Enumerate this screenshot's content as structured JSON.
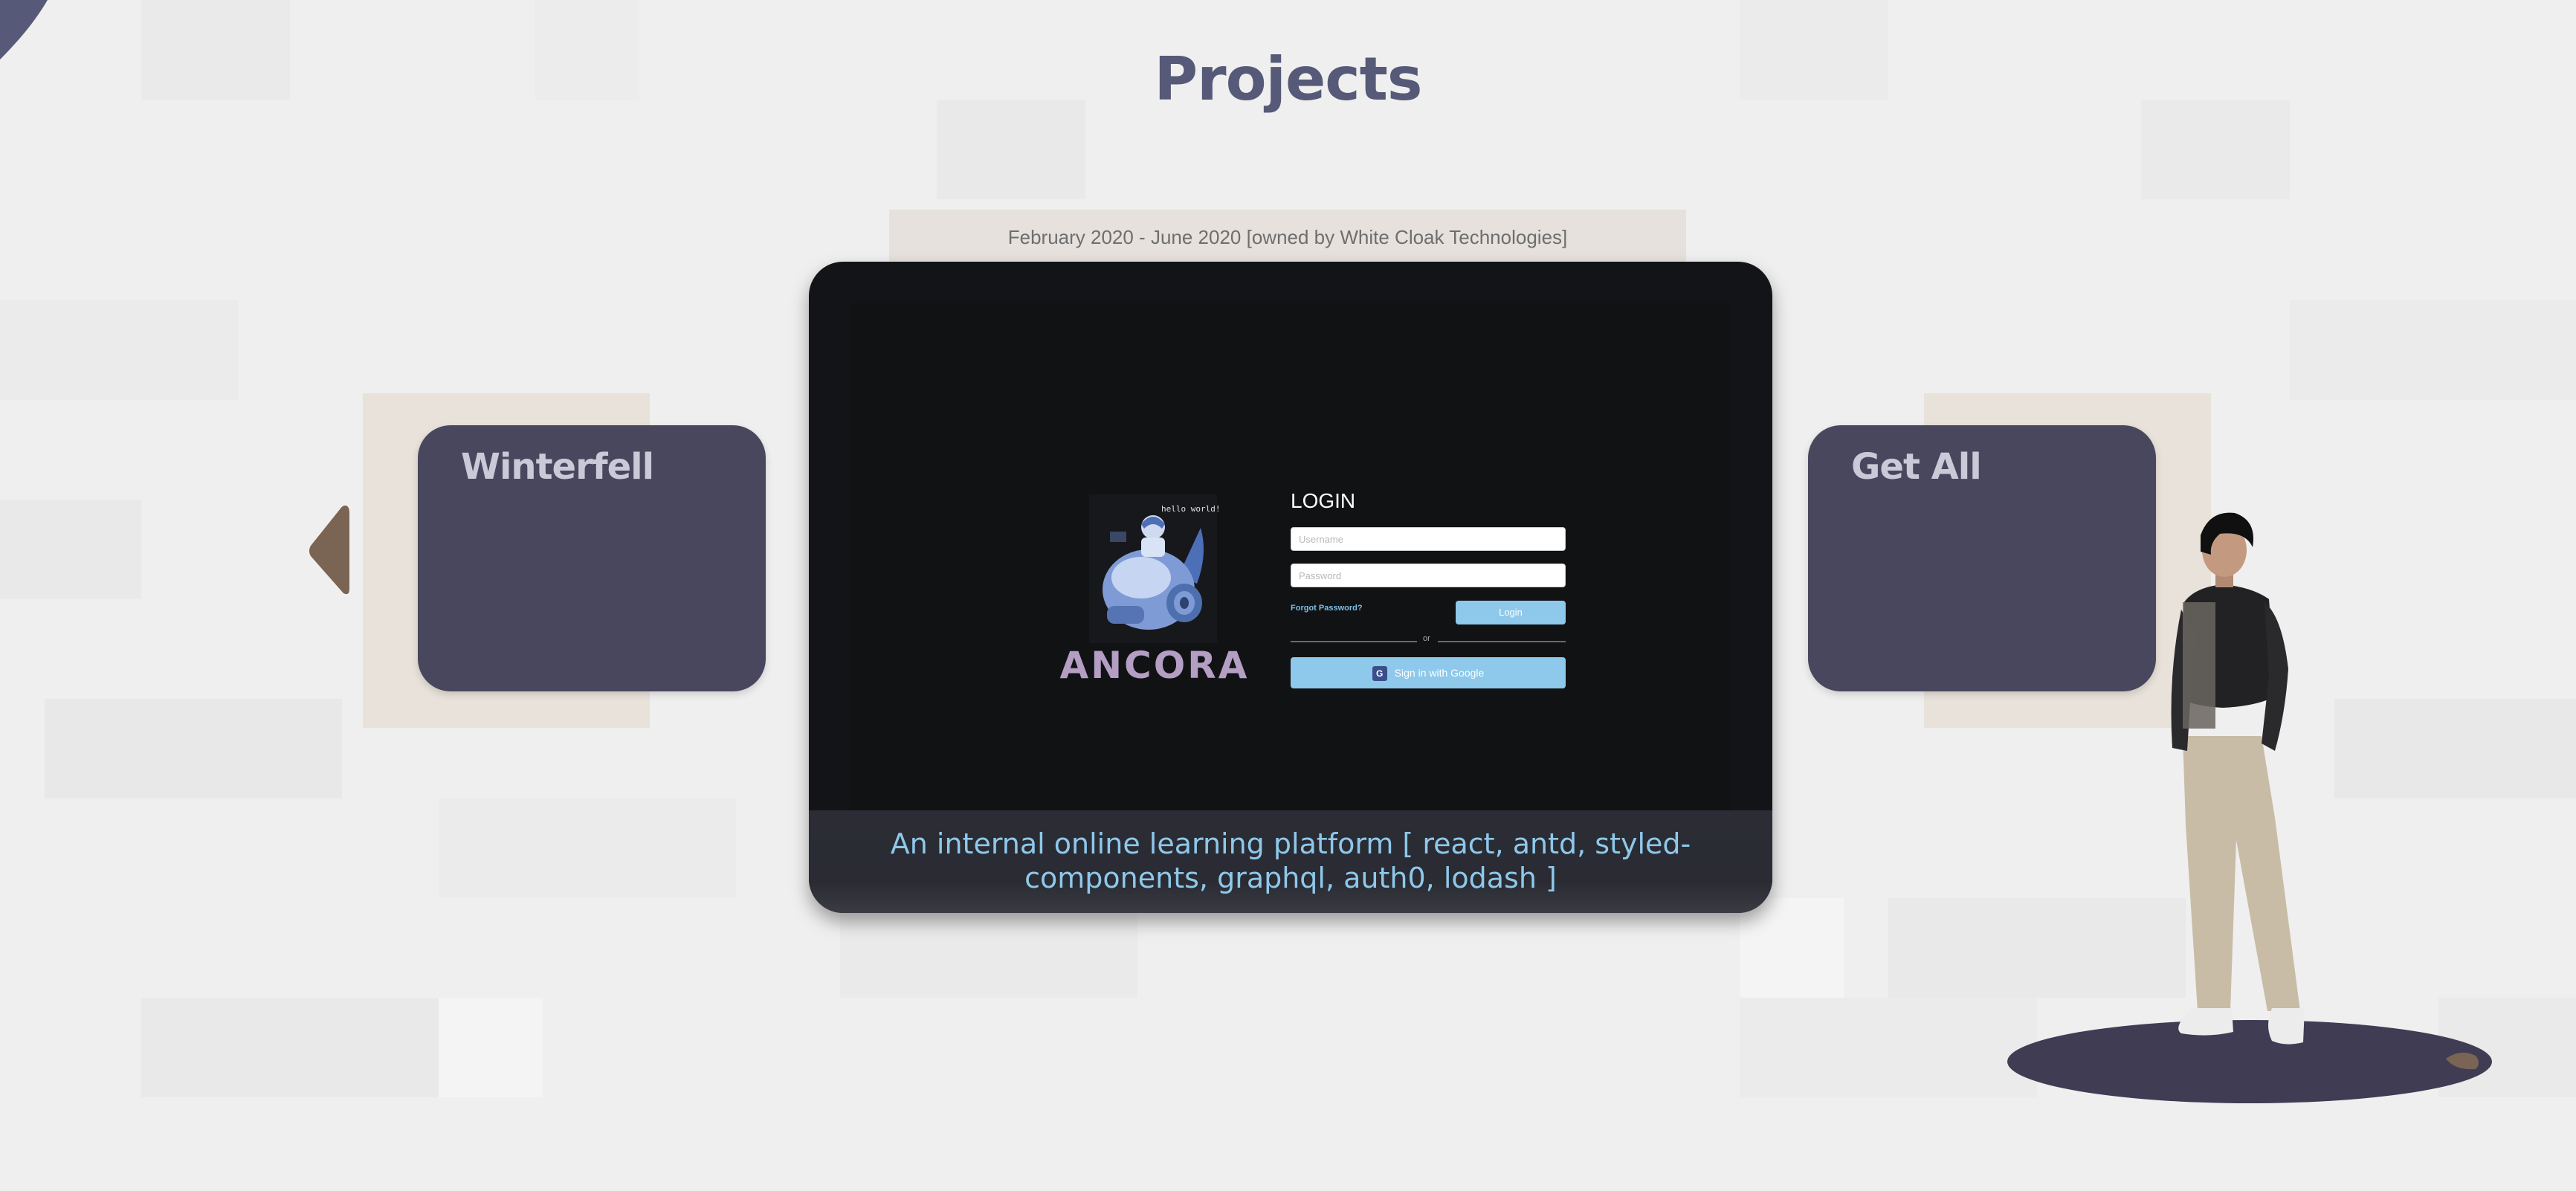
{
  "page": {
    "title": "Projects"
  },
  "carousel": {
    "previous": {
      "title": "Winterfell"
    },
    "current": {
      "dates": "February 2020 - June 2020 [owned by White Cloak Technologies]",
      "description": "An internal online learning platform [ react, antd, styled-components, graphql, auth0, lodash ]",
      "screenshot": {
        "logo_text": "ANCORA",
        "logo_caption": "hello world!",
        "login_heading": "LOGIN",
        "username_placeholder": "Username",
        "password_placeholder": "Password",
        "forgot_label": "Forgot Password?",
        "login_button": "Login",
        "divider_label": "or",
        "google_button": "Sign in with Google"
      }
    },
    "next": {
      "title": "Get All"
    }
  },
  "colors": {
    "background": "#efefef",
    "title": "#565a78",
    "side_card": "#48475e",
    "accent_arrow": "#7a6453",
    "caption_text": "#8ec8ea",
    "platform": "#3f3c54"
  },
  "icons": [
    "previous-arrow-icon",
    "google-icon",
    "ancora-mascot-icon"
  ]
}
